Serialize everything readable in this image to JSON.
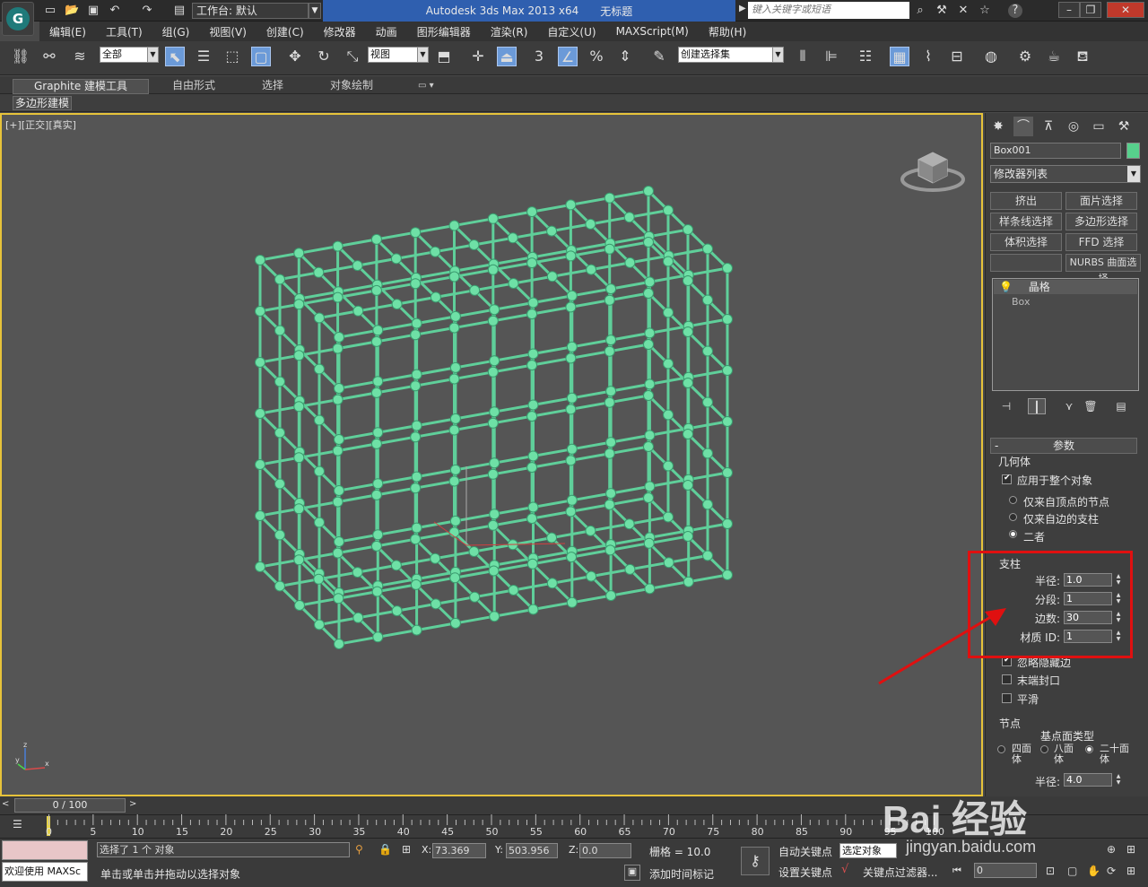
{
  "titlebar": {
    "workspace": "工作台: 默认",
    "app_title": "Autodesk 3ds Max  2013 x64",
    "doc_title": "无标题",
    "search_placeholder": "键入关键字或短语",
    "help": "?"
  },
  "menu": [
    "编辑(E)",
    "工具(T)",
    "组(G)",
    "视图(V)",
    "创建(C)",
    "修改器",
    "动画",
    "图形编辑器",
    "渲染(R)",
    "自定义(U)",
    "MAXScript(M)",
    "帮助(H)"
  ],
  "toolbar": {
    "filter_value": "全部",
    "coord_value": "视图",
    "selection_set_value": "创建选择集",
    "snap_label": "3"
  },
  "ribbon": {
    "tabs": [
      "Graphite 建模工具",
      "自由形式",
      "选择",
      "对象绘制"
    ],
    "sub": "多边形建模"
  },
  "viewport": {
    "label": "[+][正交][真实]"
  },
  "command_panel": {
    "object_name": "Box001",
    "object_color": "#57d08c",
    "modifier_list": "修改器列表",
    "buttons": [
      "挤出",
      "面片选择",
      "样条线选择",
      "多边形选择",
      "体积选择",
      "FFD 选择",
      "",
      "NURBS 曲面选择"
    ],
    "stack": [
      "晶格",
      "Box"
    ],
    "rollout_title": "参数",
    "geometry_group": "几何体",
    "apply_whole": "应用于整个对象",
    "radio_options": [
      "仅来自顶点的节点",
      "仅来自边的支柱",
      "二者"
    ],
    "struts_group": "支柱",
    "struts": [
      {
        "label": "半径:",
        "value": "1.0"
      },
      {
        "label": "分段:",
        "value": "1"
      },
      {
        "label": "边数:",
        "value": "30"
      },
      {
        "label": "材质 ID:",
        "value": "1"
      }
    ],
    "ignore_hidden": "忽略隐藏边",
    "end_caps": "末端封口",
    "smooth": "平滑",
    "joints_group": "节点",
    "base_type": "基点面类型",
    "joint_types": [
      "四面体",
      "八面体",
      "二十面体"
    ],
    "joint_radius_label": "半径:",
    "joint_radius": "4.0"
  },
  "timeline": {
    "slider": "0 / 100",
    "ticks": [
      "0",
      "5",
      "10",
      "15",
      "20",
      "25",
      "30",
      "35",
      "40",
      "45",
      "50",
      "55",
      "60",
      "65",
      "70",
      "75",
      "80",
      "85",
      "90",
      "95",
      "100"
    ]
  },
  "status": {
    "welcome": "欢迎使用 MAXSc",
    "selection": "选择了 1 个 对象",
    "hint": "单击或单击并拖动以选择对象",
    "x_label": "X:",
    "x": "73.369",
    "y_label": "Y:",
    "y": "503.956",
    "z_label": "Z:",
    "z": "0.0",
    "grid": "栅格 = 10.0",
    "add_time_tag": "添加时间标记",
    "auto_key": "自动关键点",
    "selected_obj": "选定对象",
    "set_key": "设置关键点",
    "key_filter": "关键点过滤器...",
    "frame": "0"
  },
  "watermark": "Bai 经验",
  "watermark_url": "jingyan.baidu.com"
}
